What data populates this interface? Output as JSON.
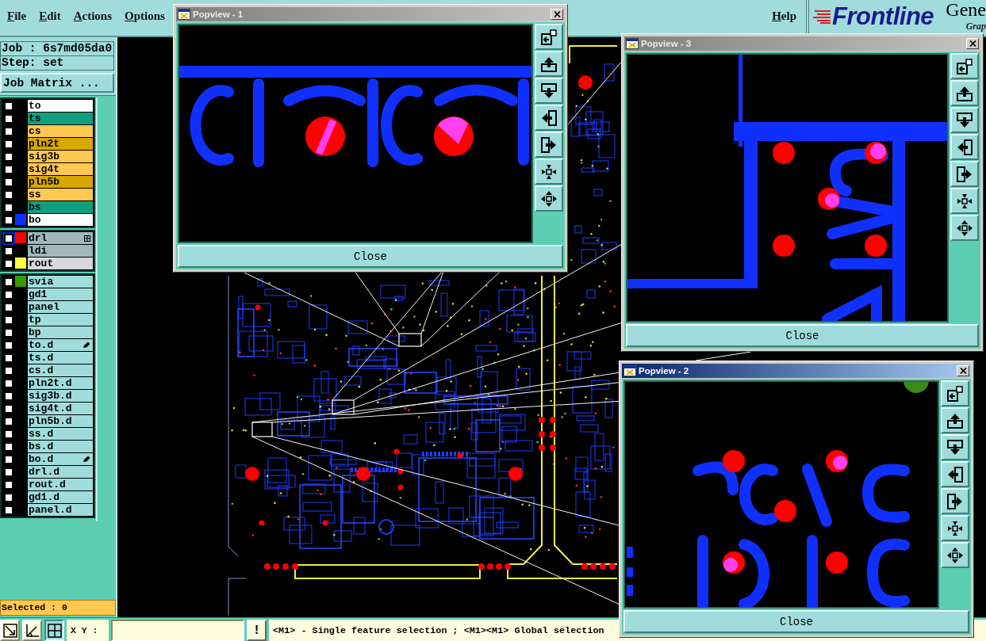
{
  "menu": {
    "items": [
      {
        "label": "File"
      },
      {
        "label": "Edit"
      },
      {
        "label": "Actions"
      },
      {
        "label": "Options"
      }
    ],
    "help": "Help"
  },
  "brand": {
    "logo": "Frontline",
    "product": "Gene",
    "tagline": "Grap"
  },
  "job_panel": {
    "job": "Job : 6s7md05da0",
    "step": "Step: set",
    "matrix_button": "Job Matrix ..."
  },
  "layer_groups": [
    {
      "layers": [
        {
          "name": "to",
          "color": "#ffffff",
          "checked": false,
          "active": false
        },
        {
          "name": "ts",
          "color": "#10a080",
          "checked": false,
          "active": false
        },
        {
          "name": "cs",
          "color": "#ffc850",
          "checked": false,
          "active": false
        },
        {
          "name": "pln2t",
          "color": "#d8a800",
          "checked": false,
          "active": false
        },
        {
          "name": "sig3b",
          "color": "#ffc850",
          "checked": false,
          "active": false
        },
        {
          "name": "sig4t",
          "color": "#ffc850",
          "checked": false,
          "active": false
        },
        {
          "name": "pln5b",
          "color": "#d8a800",
          "checked": false,
          "active": false
        },
        {
          "name": "ss",
          "color": "#ffc850",
          "checked": false,
          "active": false
        },
        {
          "name": "bs",
          "color": "#10a080",
          "checked": false,
          "active": false
        },
        {
          "name": "bo",
          "color": "#ffffff",
          "swatch": {
            "color": "#1030ff"
          },
          "checked": false,
          "active": false
        }
      ]
    },
    {
      "layers": [
        {
          "name": "drl",
          "color": "#a0b8bc",
          "swatch": {
            "color": "#ff0000"
          },
          "checked": false,
          "active": true
        },
        {
          "name": "ldi",
          "color": "#a0b8bc",
          "checked": false,
          "active": false
        },
        {
          "name": "rout",
          "color": "#d8d8d8",
          "swatch": {
            "color": "#ffff40"
          },
          "checked": false,
          "active": false
        }
      ]
    },
    {
      "layers": [
        {
          "name": "svia",
          "color": "#a0dcdc",
          "swatch": {
            "color": "#3a9a00"
          },
          "checked": false,
          "active": false
        },
        {
          "name": "gd1",
          "color": "#a0dcdc",
          "checked": false,
          "active": false
        },
        {
          "name": "panel",
          "color": "#a0dcdc",
          "checked": false,
          "active": false
        },
        {
          "name": "tp",
          "color": "#a0dcdc",
          "checked": false,
          "active": false
        },
        {
          "name": "bp",
          "color": "#a0dcdc",
          "checked": false,
          "active": false
        },
        {
          "name": "to.d",
          "color": "#a0dcdc",
          "checked": false,
          "active": false
        },
        {
          "name": "ts.d",
          "color": "#a0dcdc",
          "checked": false,
          "active": false
        },
        {
          "name": "cs.d",
          "color": "#a0dcdc",
          "checked": false,
          "active": false
        },
        {
          "name": "pln2t.d",
          "color": "#a0dcdc",
          "checked": false,
          "active": false
        },
        {
          "name": "sig3b.d",
          "color": "#a0dcdc",
          "checked": false,
          "active": false
        },
        {
          "name": "sig4t.d",
          "color": "#a0dcdc",
          "checked": false,
          "active": false
        },
        {
          "name": "pln5b.d",
          "color": "#a0dcdc",
          "checked": false,
          "active": false
        },
        {
          "name": "ss.d",
          "color": "#a0dcdc",
          "checked": false,
          "active": false
        },
        {
          "name": "bs.d",
          "color": "#a0dcdc",
          "checked": false,
          "active": false
        },
        {
          "name": "bo.d",
          "color": "#a0dcdc",
          "checked": false,
          "active": false
        },
        {
          "name": "drl.d",
          "color": "#a0dcdc",
          "checked": false,
          "active": false
        },
        {
          "name": "rout.d",
          "color": "#a0dcdc",
          "checked": false,
          "active": false
        },
        {
          "name": "gd1.d",
          "color": "#a0dcdc",
          "checked": false,
          "active": false
        },
        {
          "name": "panel.d",
          "color": "#a0dcdc",
          "checked": false,
          "active": false
        }
      ]
    }
  ],
  "selection": "Selected : 0",
  "popviews": [
    {
      "title": "Popview - 1",
      "active": false,
      "close": "Close"
    },
    {
      "title": "Popview - 3",
      "active": false,
      "close": "Close"
    },
    {
      "title": "Popview - 2",
      "active": true,
      "close": "Close"
    }
  ],
  "status_bar": {
    "tools": [
      {
        "selected": false
      },
      {
        "selected": false
      },
      {
        "selected": true
      }
    ],
    "coord_label": "X Y :",
    "alert_button": "!",
    "hint": "<M1> - Single feature selection ; <M1><M1> Global selection"
  }
}
